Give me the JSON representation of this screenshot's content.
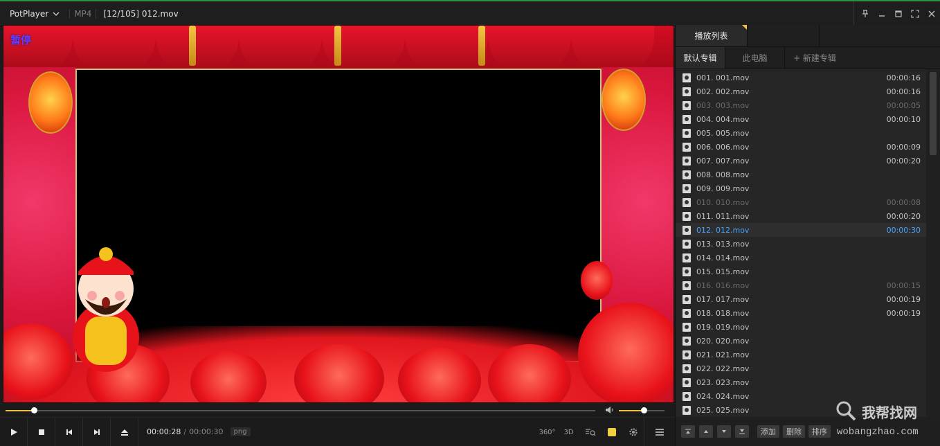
{
  "titlebar": {
    "app_name": "PotPlayer",
    "format": "MP4",
    "file_title": "[12/105] 012.mov",
    "icons": [
      "pin-icon",
      "minimize-icon",
      "maximize-icon",
      "fullscreen-icon",
      "close-icon"
    ]
  },
  "video": {
    "osd_text": "暂停"
  },
  "seek": {
    "progress": 0.048,
    "volume": 0.55
  },
  "controls": {
    "time_current": "00:00:28",
    "time_separator": "/",
    "time_total": "00:00:30",
    "badge": "png",
    "tool_360": "360°",
    "tool_3d": "3D"
  },
  "playlist": {
    "main_tab": "播放列表",
    "sub_tabs": [
      "默认专辑",
      "此电脑",
      "+ 新建专辑"
    ],
    "items": [
      {
        "name": "001. 001.mov",
        "duration": "00:00:16",
        "state": "normal"
      },
      {
        "name": "002. 002.mov",
        "duration": "00:00:16",
        "state": "normal"
      },
      {
        "name": "003. 003.mov",
        "duration": "00:00:05",
        "state": "dim"
      },
      {
        "name": "004. 004.mov",
        "duration": "00:00:10",
        "state": "normal"
      },
      {
        "name": "005. 005.mov",
        "duration": "",
        "state": "normal"
      },
      {
        "name": "006. 006.mov",
        "duration": "00:00:09",
        "state": "normal"
      },
      {
        "name": "007. 007.mov",
        "duration": "00:00:20",
        "state": "normal"
      },
      {
        "name": "008. 008.mov",
        "duration": "",
        "state": "normal"
      },
      {
        "name": "009. 009.mov",
        "duration": "",
        "state": "normal"
      },
      {
        "name": "010. 010.mov",
        "duration": "00:00:08",
        "state": "dim"
      },
      {
        "name": "011. 011.mov",
        "duration": "00:00:20",
        "state": "normal"
      },
      {
        "name": "012. 012.mov",
        "duration": "00:00:30",
        "state": "current"
      },
      {
        "name": "013. 013.mov",
        "duration": "",
        "state": "normal"
      },
      {
        "name": "014. 014.mov",
        "duration": "",
        "state": "normal"
      },
      {
        "name": "015. 015.mov",
        "duration": "",
        "state": "normal"
      },
      {
        "name": "016. 016.mov",
        "duration": "00:00:15",
        "state": "dim"
      },
      {
        "name": "017. 017.mov",
        "duration": "00:00:19",
        "state": "normal"
      },
      {
        "name": "018. 018.mov",
        "duration": "00:00:19",
        "state": "normal"
      },
      {
        "name": "019. 019.mov",
        "duration": "",
        "state": "normal"
      },
      {
        "name": "020. 020.mov",
        "duration": "",
        "state": "normal"
      },
      {
        "name": "021. 021.mov",
        "duration": "",
        "state": "normal"
      },
      {
        "name": "022. 022.mov",
        "duration": "",
        "state": "normal"
      },
      {
        "name": "023. 023.mov",
        "duration": "",
        "state": "normal"
      },
      {
        "name": "024. 024.mov",
        "duration": "",
        "state": "normal"
      },
      {
        "name": "025. 025.mov",
        "duration": "",
        "state": "normal"
      }
    ],
    "footer": {
      "add": "添加",
      "delete": "删除",
      "sort": "排序"
    }
  },
  "watermark": {
    "title": "我帮找网",
    "url": "wobangzhao.com"
  },
  "colors": {
    "accent": "#f0c040",
    "current_item": "#4aa3ff",
    "titlebar_top": "#2f8f46"
  }
}
